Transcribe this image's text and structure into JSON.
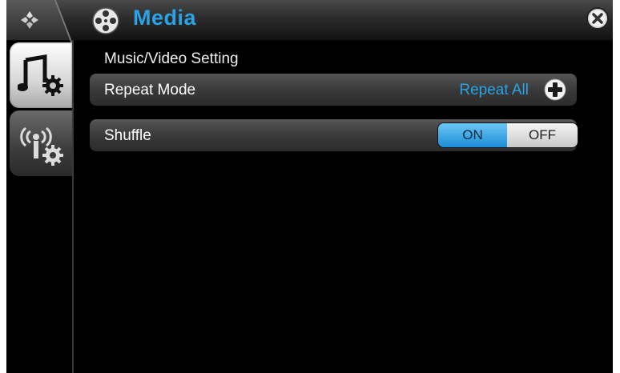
{
  "header": {
    "title": "Media"
  },
  "section": {
    "title": "Music/Video Setting"
  },
  "settings": [
    {
      "label": "Repeat Mode",
      "value": "Repeat All"
    },
    {
      "label": "Shuffle",
      "on_label": "ON",
      "off_label": "OFF",
      "selected": "ON"
    }
  ],
  "colors": {
    "accent": "#2aa3e6",
    "background": "#000000"
  },
  "icons": {
    "home": "home-icon",
    "media": "film-reel-icon",
    "close": "close-icon",
    "tab_music": "music-settings-icon",
    "tab_network": "wireless-settings-icon",
    "add": "plus-icon"
  }
}
